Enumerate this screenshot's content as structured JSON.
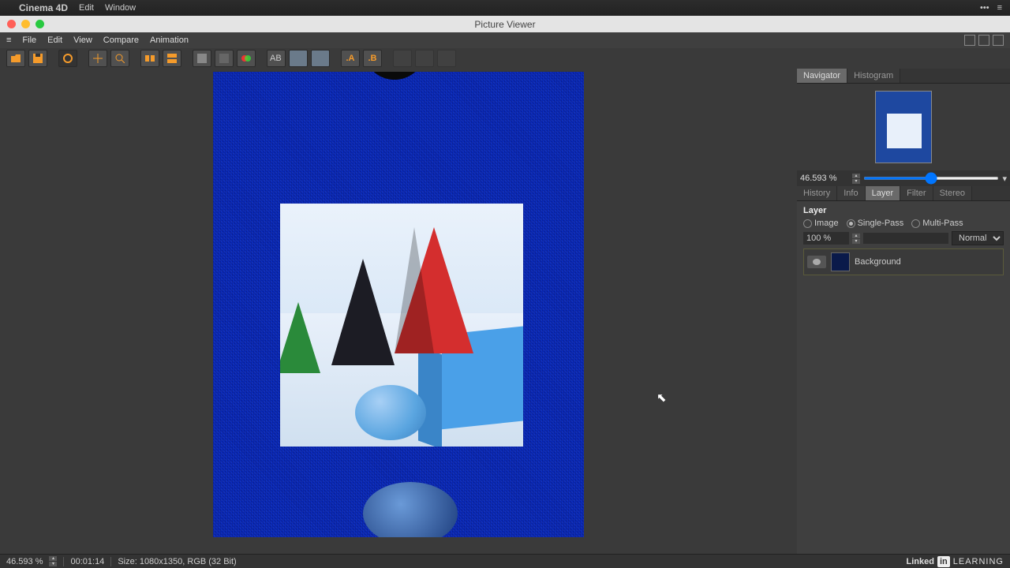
{
  "mac_menu": {
    "app": "Cinema 4D",
    "items": [
      "Edit",
      "Window"
    ]
  },
  "window_title": "Picture Viewer",
  "submenu": [
    "File",
    "Edit",
    "View",
    "Compare",
    "Animation"
  ],
  "side": {
    "nav_tabs": {
      "navigator": "Navigator",
      "histogram": "Histogram"
    },
    "zoom": "46.593 %",
    "tabs2": {
      "history": "History",
      "info": "Info",
      "layer": "Layer",
      "filter": "Filter",
      "stereo": "Stereo"
    },
    "layer_header": "Layer",
    "radios": {
      "image": "Image",
      "single": "Single-Pass",
      "multi": "Multi-Pass"
    },
    "opacity": "100 %",
    "blend": "Normal",
    "layer_name": "Background"
  },
  "status": {
    "zoom": "46.593 %",
    "time": "00:01:14",
    "size": "Size: 1080x1350, RGB (32 Bit)",
    "brand_a": "Linked",
    "brand_b": "in",
    "brand_c": "LEARNING"
  }
}
